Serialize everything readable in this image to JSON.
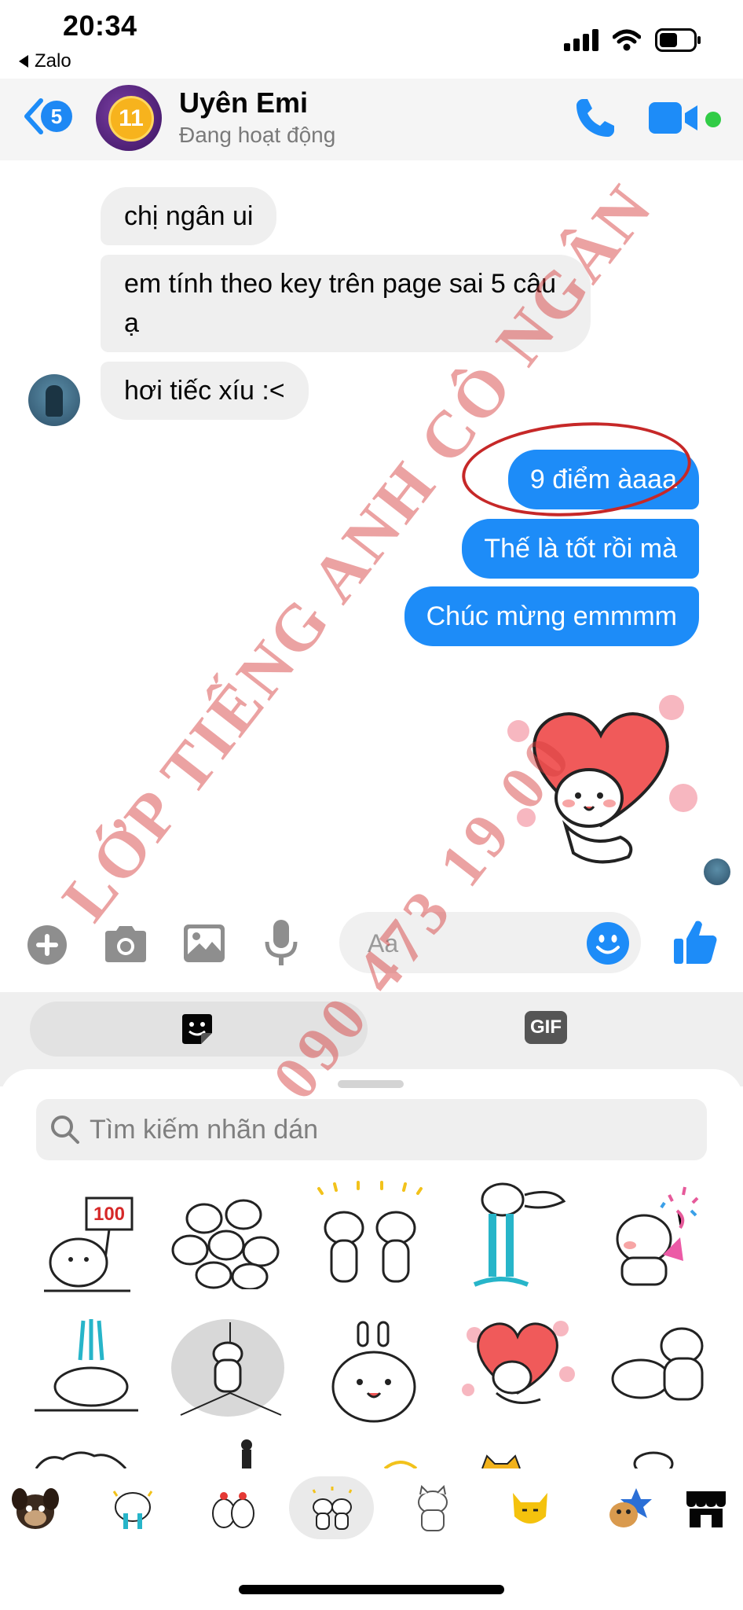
{
  "status_bar": {
    "time": "20:34",
    "back_app": "Zalo"
  },
  "header": {
    "unread_count": "5",
    "avatar_badge": "11",
    "contact_name": "Uyên Emi",
    "contact_status": "Đang hoạt động",
    "online": true
  },
  "messages": {
    "incoming": [
      "chị ngân ui",
      "em tính theo key trên page sai 5 câu ạ",
      "hơi tiếc xíu :<"
    ],
    "outgoing": [
      "9 điểm àaaa",
      "Thế là tốt rồi mà",
      "Chúc mừng emmmm"
    ],
    "sent_sticker": "heart-bunny-sticker"
  },
  "composer": {
    "placeholder": "Aa",
    "icons": [
      "plus-icon",
      "camera-icon",
      "gallery-icon",
      "microphone-icon",
      "emoji-icon",
      "thumbs-up-icon"
    ]
  },
  "sticker_panel": {
    "tabs": [
      "sticker-tab",
      "GIF"
    ],
    "search_placeholder": "Tìm kiếm nhãn dán",
    "stickers": [
      "bunny-100-sign-sticker",
      "bunny-group-sticker",
      "two-bunnies-praying-sticker",
      "bunny-crying-sticker",
      "bunny-confetti-sticker",
      "bunny-fountain-sticker",
      "bunny-corner-sticker",
      "bunny-surprised-sticker",
      "heart-bunny-sticker",
      "bunny-hug-sticker"
    ],
    "tray": [
      "dog-pack",
      "bunny-crying-pack",
      "chicken-pack",
      "bunny-pack",
      "cat-pack",
      "yellow-cat-pack",
      "dog-star-pack",
      "sticker-store-icon"
    ]
  },
  "watermark": {
    "line1": "LỚP TIẾNG ANH CÔ NGÂN",
    "line2": "090 473 19 00"
  },
  "colors": {
    "messenger_blue": "#1d8cf8",
    "incoming_bubble": "#efefef",
    "online_green": "#31cc46",
    "annotation_red": "#c62828"
  }
}
